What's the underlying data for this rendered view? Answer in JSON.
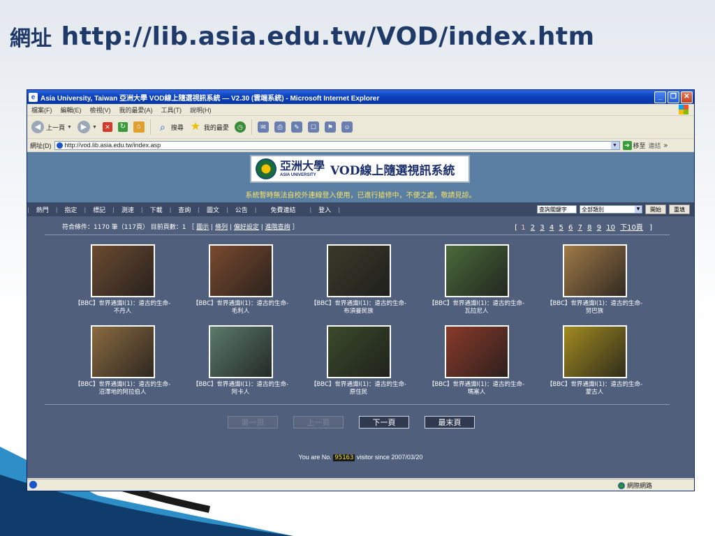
{
  "slide": {
    "title_prefix": "網址",
    "title_url": "http://lib.asia.edu.tw/VOD/index.htm"
  },
  "window": {
    "title": "Asia University, Taiwan 亞洲大學 VOD線上隨選視訊系統 — V2.30 (雲端系統) - Microsoft Internet Explorer",
    "controls": {
      "minimize": "_",
      "maximize": "❐",
      "close": "✕"
    }
  },
  "menubar": [
    "檔案(F)",
    "編輯(E)",
    "檢視(V)",
    "我的最愛(A)",
    "工具(T)",
    "說明(H)"
  ],
  "toolbar": {
    "back": "上一頁",
    "search": "搜尋",
    "favorites": "我的最愛"
  },
  "address": {
    "label": "網址(D)",
    "url": "http://vod.lib.asia.edu.tw/index.asp",
    "go": "移至",
    "links": "連結"
  },
  "site": {
    "logo_cn": "亞洲大學",
    "logo_en": "ASIA UNIVERSITY",
    "system_name": "VOD線上隨選視訊系統",
    "notice": "系統暫時無法自校外連線登入使用，已進行搶修中，不便之處，敬請見諒。",
    "nav": [
      "熱門",
      "指定",
      "標記",
      "測速",
      "下載",
      "查詢",
      "圖文",
      "公告",
      "免費連結",
      "登入"
    ],
    "search_placeholder": "查詢關鍵字",
    "category": "全部類別",
    "start_btn": "開始",
    "reset_btn": "重填",
    "result_summary": "符合條件：1170 筆（117頁） 目前頁數：1 ［",
    "view_links": [
      "圖示",
      "條列",
      "偏好設定",
      "進階查詢"
    ],
    "result_end": "］",
    "pager": {
      "open": "[",
      "current": "1",
      "pages": [
        "2",
        "3",
        "4",
        "5",
        "6",
        "7",
        "8",
        "9",
        "10"
      ],
      "next10": "下10頁",
      "close": "]"
    },
    "videos": [
      {
        "line1": "【BBC】世界通識I(1)：遠古的生命-",
        "line2": "不丹人",
        "color": "#6b4a30"
      },
      {
        "line1": "【BBC】世界通識I(1)：遠古的生命-",
        "line2": "毛利人",
        "color": "#7a4a2e"
      },
      {
        "line1": "【BBC】世界通識I(1)：遠古的生命-",
        "line2": "布須曼民族",
        "color": "#3a3a2a"
      },
      {
        "line1": "【BBC】世界通識I(1)：遠古的生命-",
        "line2": "瓦拉尼人",
        "color": "#4a6a3a"
      },
      {
        "line1": "【BBC】世界通識I(1)：遠古的生命-",
        "line2": "努巴族",
        "color": "#a07a48"
      },
      {
        "line1": "【BBC】世界通識I(1)：遠古的生命-",
        "line2": "沼澤地的阿拉伯人",
        "color": "#8a6a40"
      },
      {
        "line1": "【BBC】世界通識I(1)：遠古的生命-",
        "line2": "阿卡人",
        "color": "#5a7a6a"
      },
      {
        "line1": "【BBC】世界通識I(1)：遠古的生命-",
        "line2": "原住民",
        "color": "#3a4a2a"
      },
      {
        "line1": "【BBC】世界通識I(1)：遠古的生命-",
        "line2": "瑪塞人",
        "color": "#8a3a2a"
      },
      {
        "line1": "【BBC】世界通識I(1)：遠古的生命-",
        "line2": "蒙古人",
        "color": "#a08a20"
      }
    ],
    "page_buttons": {
      "first": "第一頁",
      "prev": "上一頁",
      "next": "下一頁",
      "last": "最末頁"
    },
    "counter_prefix": "You are No.",
    "counter_value": "95163",
    "counter_suffix": "visitor since 2007/03/20"
  },
  "status": {
    "zone": "網際網路"
  }
}
